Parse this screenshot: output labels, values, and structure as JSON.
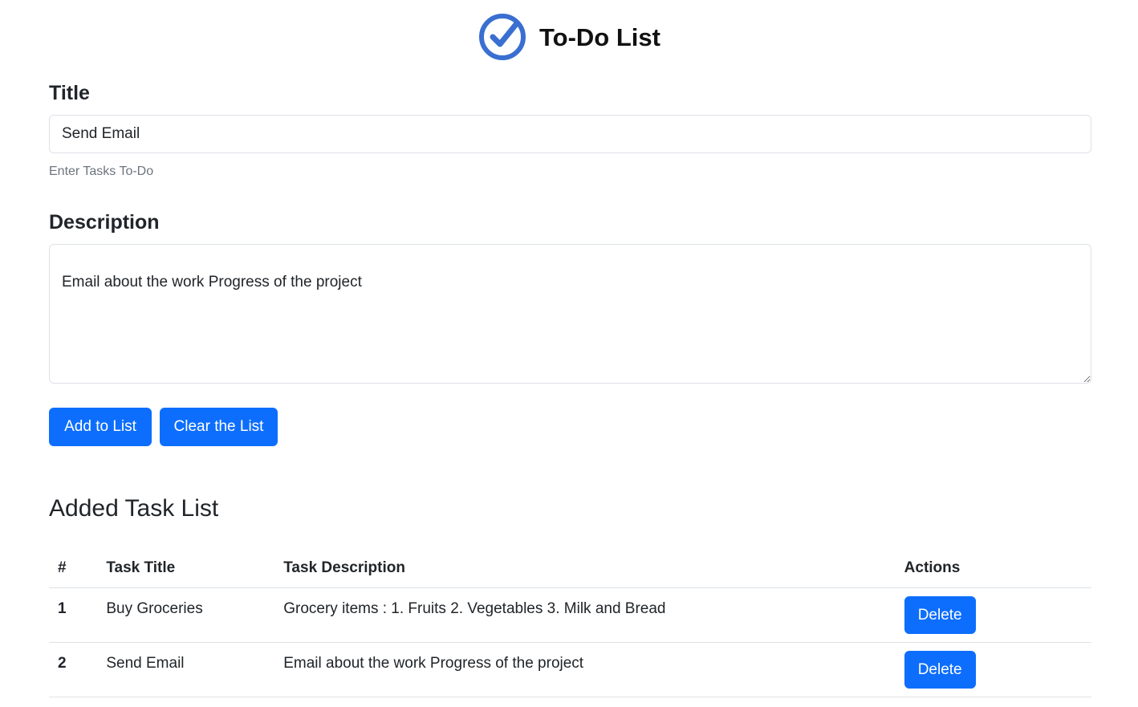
{
  "header": {
    "title": "To-Do List",
    "logo_icon": "check-circle-icon",
    "accent_color": "#3a6fd1"
  },
  "form": {
    "title_label": "Title",
    "title_value": "Send Email",
    "title_help": "Enter Tasks To-Do",
    "description_label": "Description",
    "description_value": "Email about the work Progress of the project",
    "add_button": "Add to List",
    "clear_button": "Clear the List",
    "button_color": "#0d6efd"
  },
  "task_list": {
    "heading": "Added Task List",
    "columns": [
      "#",
      "Task Title",
      "Task Description",
      "Actions"
    ],
    "rows": [
      {
        "num": "1",
        "title": "Buy Groceries",
        "description": "Grocery items : 1. Fruits 2. Vegetables 3. Milk and Bread",
        "action": "Delete"
      },
      {
        "num": "2",
        "title": "Send Email",
        "description": "Email about the work Progress of the project",
        "action": "Delete"
      }
    ]
  }
}
